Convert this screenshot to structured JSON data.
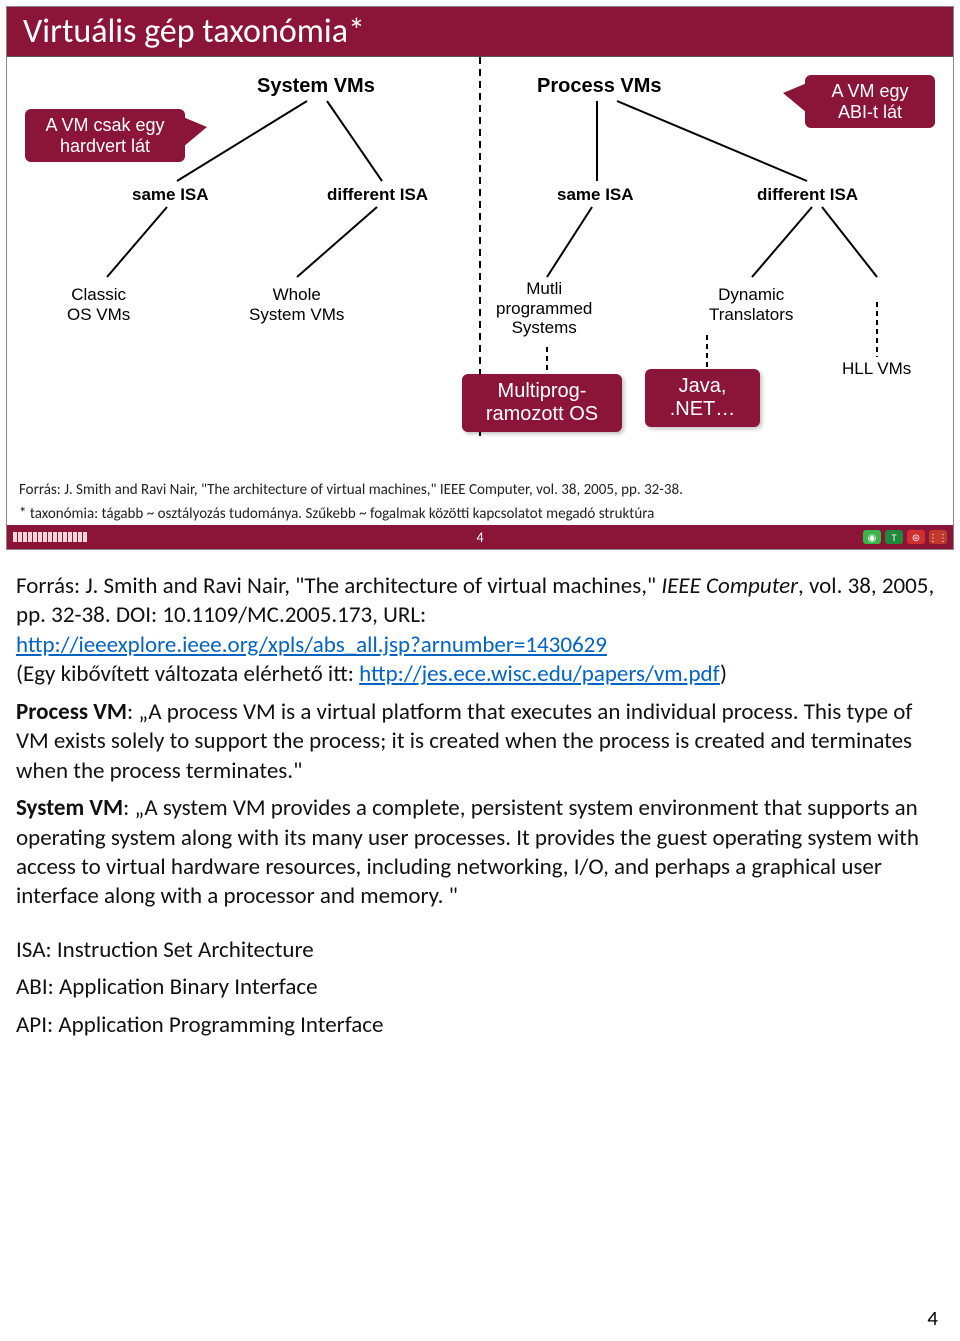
{
  "slide": {
    "title": "Virtuális gép taxonómia*",
    "callouts": {
      "system_vms": "A VM csak egy\nhardvert lát",
      "process_vms": "A VM egy\nABI-t lát"
    },
    "row1": {
      "system": "System VMs",
      "process": "Process VMs"
    },
    "row2": {
      "a": "same ISA",
      "b": "different ISA",
      "c": "same ISA",
      "d": "different ISA"
    },
    "row3": {
      "classic": "Classic\nOS VMs",
      "whole": "Whole\nSystem VMs",
      "multi": "Mutli\nprogrammed\nSystems",
      "dyn": "Dynamic\nTranslators",
      "hll": "HLL VMs"
    },
    "boxes": {
      "multiprog": "Multiprog-\nramozott OS",
      "java": "Java,\n.NET…"
    },
    "source": "Forrás: J. Smith and Ravi Nair, \"The architecture of virtual machines,\" IEEE Computer, vol. 38, 2005, pp. 32-38.",
    "footnote": "* taxonómia: tágabb ~ osztályozás tudománya.  Szűkebb ~ fogalmak közötti kapcsolatot megadó struktúra",
    "pagenum": "4"
  },
  "text": {
    "p1a": "Forrás: J. Smith and Ravi Nair, \"The architecture of virtual machines,\" ",
    "p1i": "IEEE Computer",
    "p1b": ", vol. 38, 2005, pp. 32-38. DOI: 10.1109/MC.2005.173, URL: ",
    "url1": "http://ieeexplore.ieee.org/xpls/abs_all.jsp?arnumber=1430629",
    "p1c": "(Egy kibővített változata elérhető itt: ",
    "url2": "http://jes.ece.wisc.edu/papers/vm.pdf",
    "p1d": ")",
    "p2a": "Process VM",
    "p2b": ": „A process VM is a virtual platform that executes an individual process. This type of VM exists solely to support the process; it is created when the process is created and terminates when the process terminates.\"",
    "p3a": "System VM",
    "p3b": ": „A system VM provides a complete, persistent system environment that supports an operating system along with its many user processes. It provides the guest operating system with access to virtual hardware resources, including networking, I/O, and perhaps a graphical user interface along with a processor and memory. \"",
    "acr1": "ISA: Instruction Set Architecture",
    "acr2": "ABI: Application Binary Interface",
    "acr3": "API: Application Programming Interface",
    "pagenum": "4"
  }
}
